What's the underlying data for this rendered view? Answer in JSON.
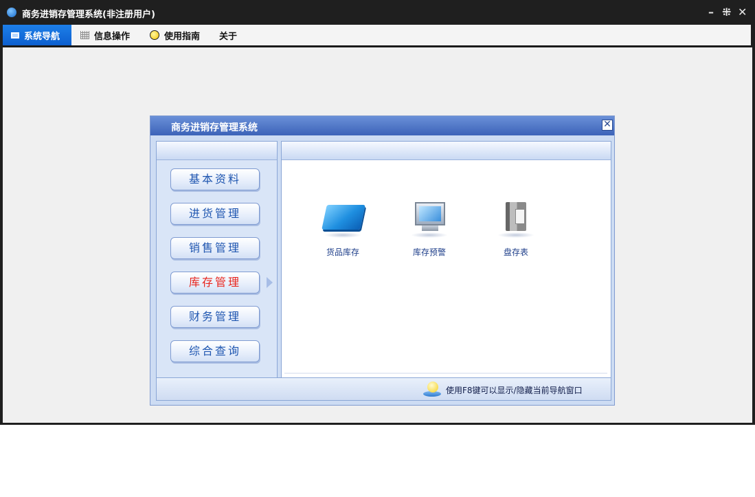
{
  "app": {
    "title": "商务进销存管理系统(非注册用户)",
    "controls": {
      "minimize": "–",
      "restore": "⁜",
      "close": "✕"
    }
  },
  "menu": {
    "tabs": [
      {
        "label": "系统导航",
        "icon": "monitor-icon",
        "active": true
      },
      {
        "label": "信息操作",
        "icon": "grid-icon",
        "active": false
      },
      {
        "label": "使用指南",
        "icon": "bulb-icon",
        "active": false
      },
      {
        "label": "关于",
        "icon": "",
        "active": false
      }
    ]
  },
  "dialog": {
    "title": "商务进销存管理系统",
    "close": "✕",
    "nav_buttons": [
      {
        "label": "基本资料",
        "active": false
      },
      {
        "label": "进货管理",
        "active": false
      },
      {
        "label": "销售管理",
        "active": false
      },
      {
        "label": "库存管理",
        "active": true
      },
      {
        "label": "财务管理",
        "active": false
      },
      {
        "label": "综合查询",
        "active": false
      }
    ],
    "functions": [
      {
        "label": "货品库存",
        "icon": "folder-icon"
      },
      {
        "label": "库存预警",
        "icon": "computer-icon"
      },
      {
        "label": "盘存表",
        "icon": "book-icon"
      }
    ],
    "status_hint": "使用F8键可以显示/隐藏当前导航窗口"
  },
  "colors": {
    "active_tab": "#1d7fe8",
    "nav_text": "#1f56b0",
    "nav_active_text": "#e8241c",
    "dialog_title": "#3c63b8"
  }
}
